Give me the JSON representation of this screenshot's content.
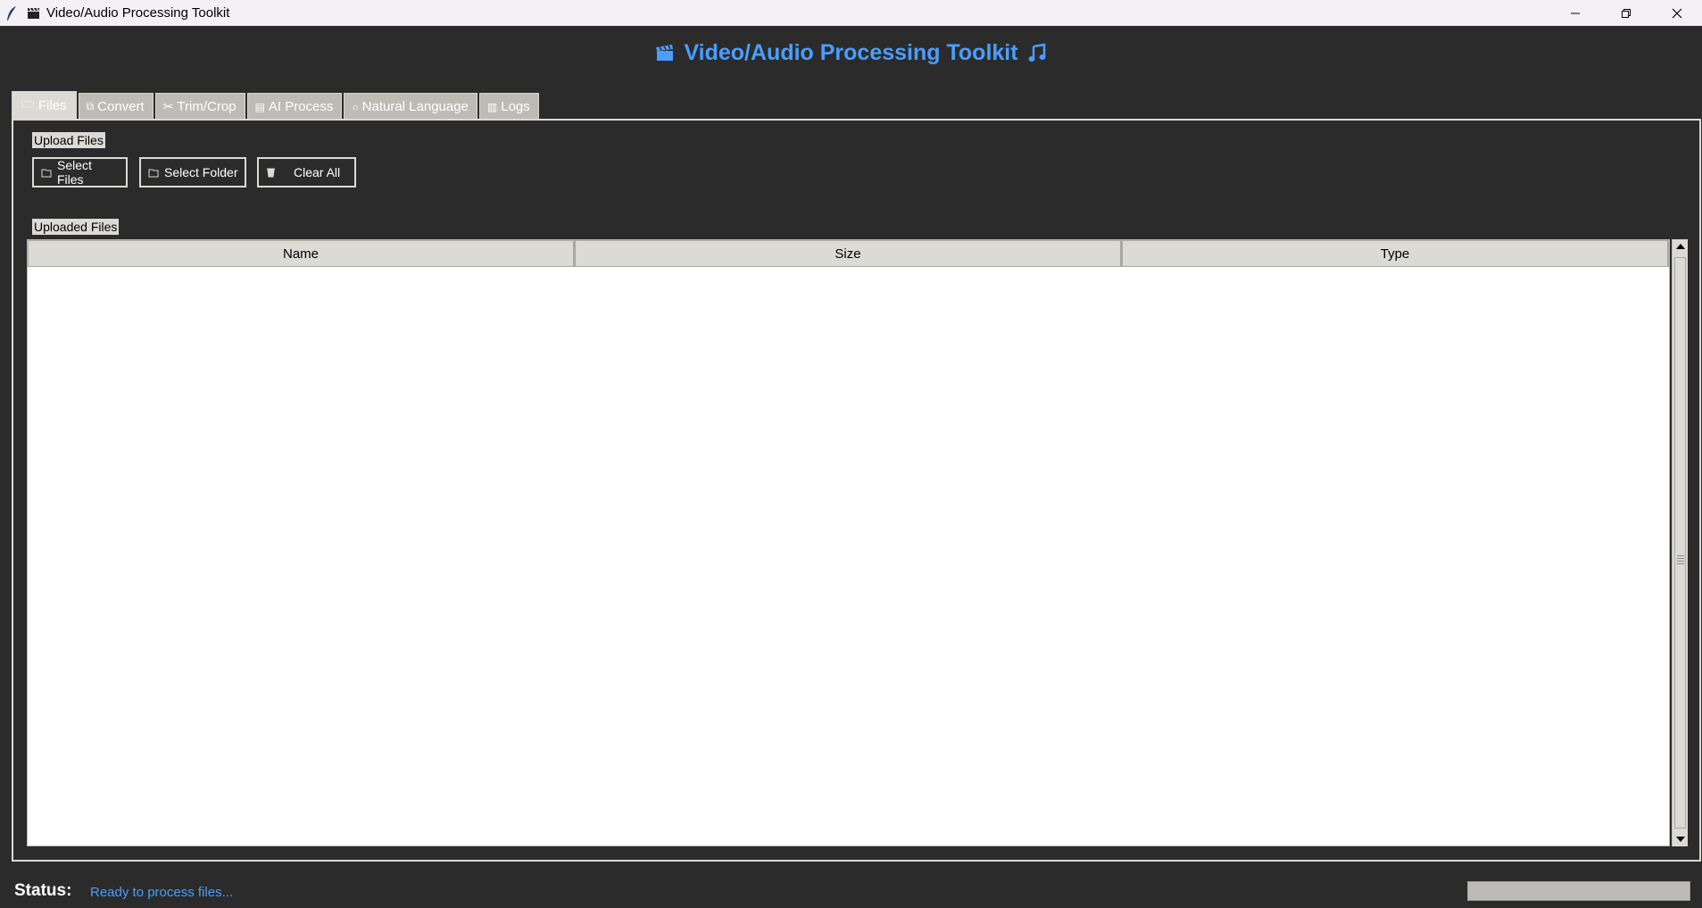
{
  "window": {
    "title": "Video/Audio Processing Toolkit",
    "app_icon": "feather-icon",
    "title_icon": "clapperboard-icon",
    "controls": [
      "minimize-icon",
      "restore-icon",
      "close-icon"
    ]
  },
  "header": {
    "title": "Video/Audio Processing Toolkit",
    "left_icon": "clapperboard-icon",
    "right_icon": "music-note-icon",
    "color": "#4a9eff"
  },
  "tabs": [
    {
      "label": "Files",
      "icon": "folder-icon",
      "active": true
    },
    {
      "label": "Convert",
      "icon": "convert-icon",
      "active": false
    },
    {
      "label": "Trim/Crop",
      "icon": "scissors-icon",
      "active": false
    },
    {
      "label": "AI Process",
      "icon": "robot-icon",
      "active": false
    },
    {
      "label": "Natural Language",
      "icon": "speech-bubble-icon",
      "active": false
    },
    {
      "label": "Logs",
      "icon": "document-icon",
      "active": false
    }
  ],
  "upload": {
    "label": "Upload Files",
    "buttons": {
      "select_files": "Select Files",
      "select_folder": "Select Folder",
      "clear_all": "Clear All"
    }
  },
  "files_table": {
    "label": "Uploaded Files",
    "columns": [
      "Name",
      "Size",
      "Type"
    ],
    "rows": []
  },
  "status": {
    "label": "Status:",
    "text": "Ready to process files...",
    "progress": 0
  }
}
